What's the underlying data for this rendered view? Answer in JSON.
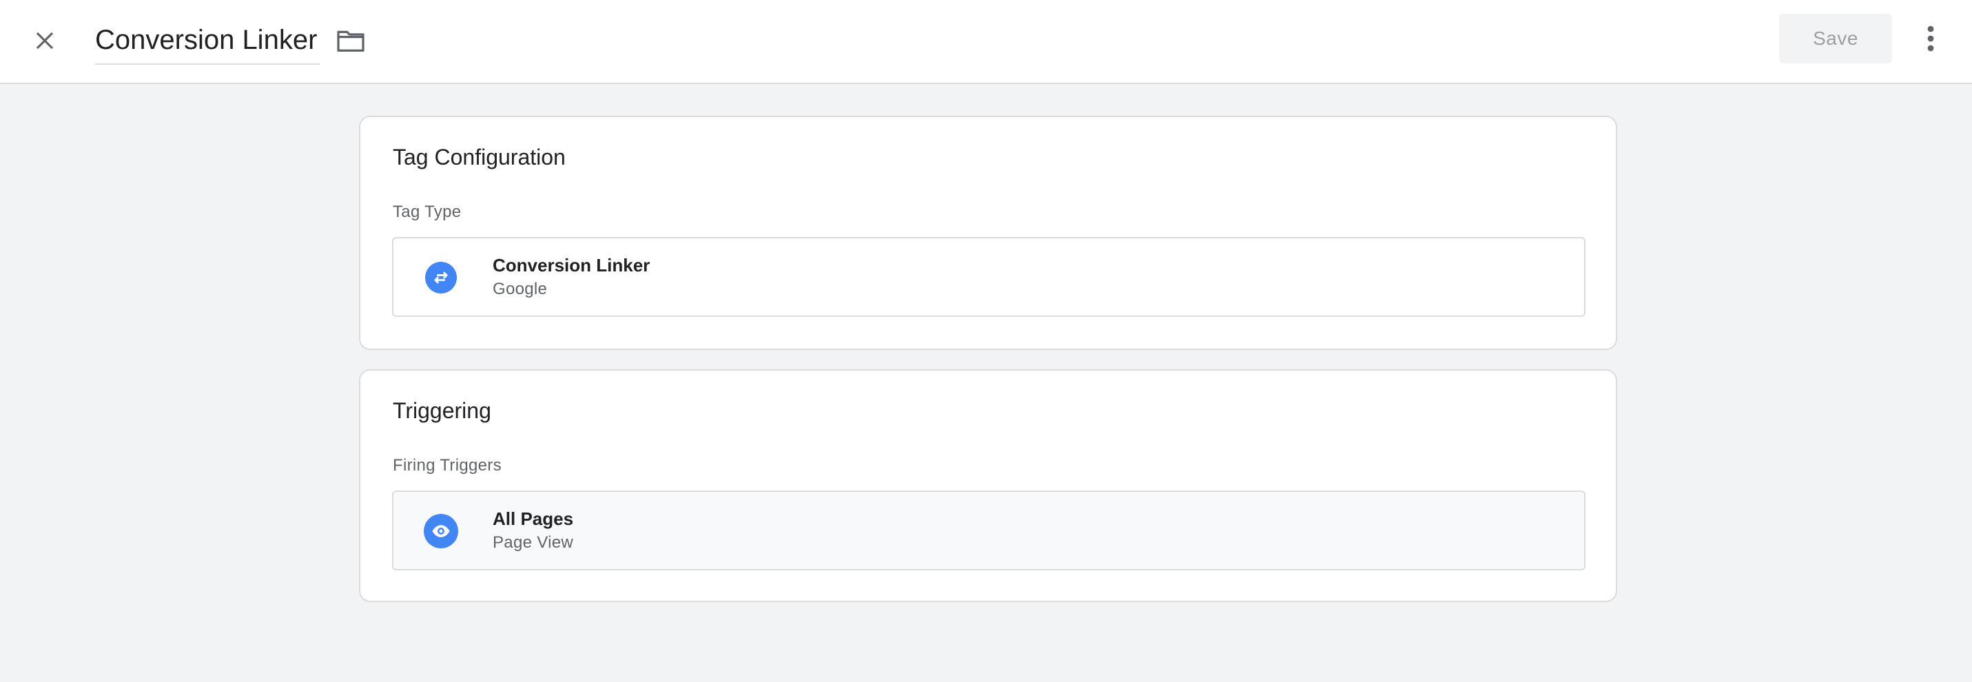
{
  "header": {
    "title": "Conversion Linker",
    "save_label": "Save",
    "icons": {
      "close": "close-icon",
      "folder": "folder-icon",
      "more": "more-vert-icon"
    }
  },
  "tag_configuration": {
    "title": "Tag Configuration",
    "section_label": "Tag Type",
    "item": {
      "name": "Conversion Linker",
      "subtitle": "Google",
      "icon": "swap-arrows-icon"
    }
  },
  "triggering": {
    "title": "Triggering",
    "section_label": "Firing Triggers",
    "item": {
      "name": "All Pages",
      "subtitle": "Page View",
      "icon": "eye-icon"
    }
  },
  "colors": {
    "accent": "#4285f4",
    "background": "#f1f3f4",
    "card": "#ffffff",
    "border": "#dadce0",
    "disabled_text": "#9aa0a6"
  }
}
